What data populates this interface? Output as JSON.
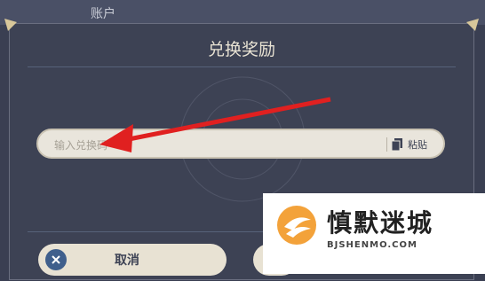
{
  "background": {
    "top_label": "账户"
  },
  "dialog": {
    "title": "兑换奖励",
    "input": {
      "placeholder": "输入兑换码",
      "value": ""
    },
    "paste_label": "粘贴",
    "cancel_label": "取消"
  },
  "watermark": {
    "name": "慎默迷城",
    "url": "BJSHENMO.COM"
  },
  "colors": {
    "dialog_bg": "#3d4254",
    "input_bg": "#e9e5dc",
    "arrow": "#e02020",
    "accent": "#3f5f8c"
  }
}
